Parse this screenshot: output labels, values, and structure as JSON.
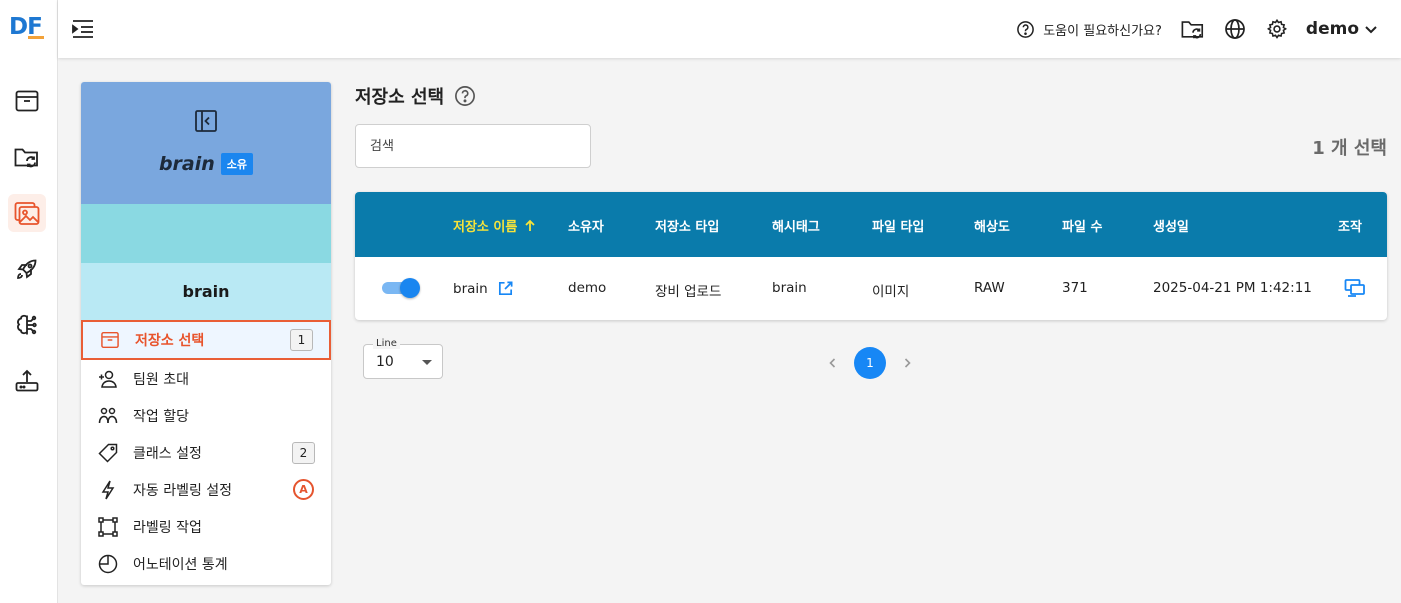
{
  "logo": {
    "d": "D",
    "f": "F"
  },
  "rail": {
    "items": [
      {
        "icon": "archive-box-icon"
      },
      {
        "icon": "folder-sync-icon"
      },
      {
        "icon": "image-gallery-icon"
      },
      {
        "icon": "rocket-icon"
      },
      {
        "icon": "brain-icon"
      },
      {
        "icon": "upload-icon"
      }
    ],
    "active_index": 2
  },
  "topbar": {
    "help_text": "도움이 필요하신가요?",
    "user_name": "demo"
  },
  "project": {
    "name": "brain",
    "owner_badge": "소유",
    "subtitle": "brain"
  },
  "menu": {
    "items": [
      {
        "label": "저장소 선택",
        "badge": "1"
      },
      {
        "label": "팀원 초대"
      },
      {
        "label": "작업 할당"
      },
      {
        "label": "클래스 설정",
        "badge": "2"
      },
      {
        "label": "자동 라벨링 설정",
        "auto_badge": "A"
      },
      {
        "label": "라벨링 작업"
      },
      {
        "label": "어노테이션 통계"
      }
    ]
  },
  "main": {
    "title": "저장소 선택",
    "search_placeholder": "검색",
    "select_count": "1 개 선택"
  },
  "table": {
    "headers": {
      "name": "저장소 이름",
      "owner": "소유자",
      "storage_type": "저장소 타입",
      "hashtag": "해시태그",
      "file_type": "파일 타입",
      "resolution": "해상도",
      "file_count": "파일 수",
      "created": "생성일",
      "action": "조작"
    },
    "rows": [
      {
        "enabled": true,
        "name": "brain",
        "owner": "demo",
        "storage_type": "장비 업로드",
        "hashtag": "brain",
        "file_type": "이미지",
        "resolution": "RAW",
        "file_count": "371",
        "created": "2025-04-21 PM 1:42:11"
      }
    ]
  },
  "pagination": {
    "rows_label": "Line",
    "rows_value": "10",
    "current_page": "1"
  },
  "colors": {
    "accent": "#e8542c",
    "header_bg": "#0a7bab",
    "primary": "#1787f5",
    "project_head": "#7aa7de"
  }
}
